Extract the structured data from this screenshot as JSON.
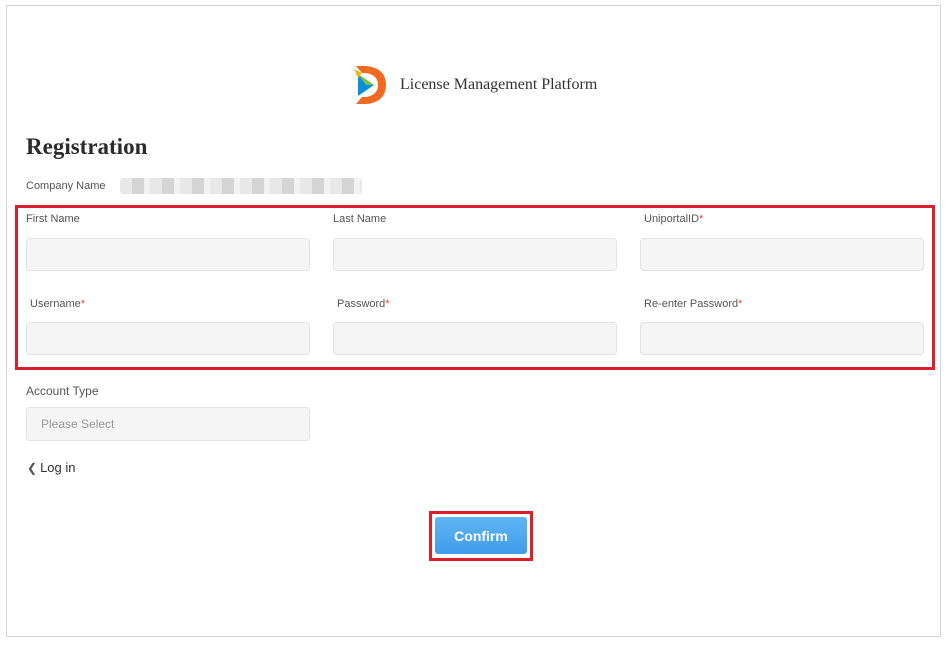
{
  "brand": {
    "name": "License Management Platform",
    "logo_icon": "brand-d-logo"
  },
  "page": {
    "title": "Registration"
  },
  "company": {
    "label": "Company Name",
    "value_obscured": true
  },
  "fields": {
    "first_name": {
      "label": "First Name",
      "required": false,
      "value": ""
    },
    "last_name": {
      "label": "Last Name",
      "required": false,
      "value": ""
    },
    "uniportal_id": {
      "label": "UniportalID",
      "required": true,
      "value": ""
    },
    "username": {
      "label": "Username",
      "required": true,
      "value": ""
    },
    "password": {
      "label": "Password",
      "required": true,
      "value": ""
    },
    "reenter_password": {
      "label": "Re-enter Password",
      "required": true,
      "value": ""
    }
  },
  "required_mark": "*",
  "account_type": {
    "label": "Account Type",
    "placeholder": "Please Select"
  },
  "login_link": {
    "label": "Log in",
    "icon": "chevron-left-icon"
  },
  "confirm": {
    "label": "Confirm"
  },
  "colors": {
    "highlight": "#d91e2e",
    "button": "#3f9ce9",
    "required": "#e2453c"
  }
}
